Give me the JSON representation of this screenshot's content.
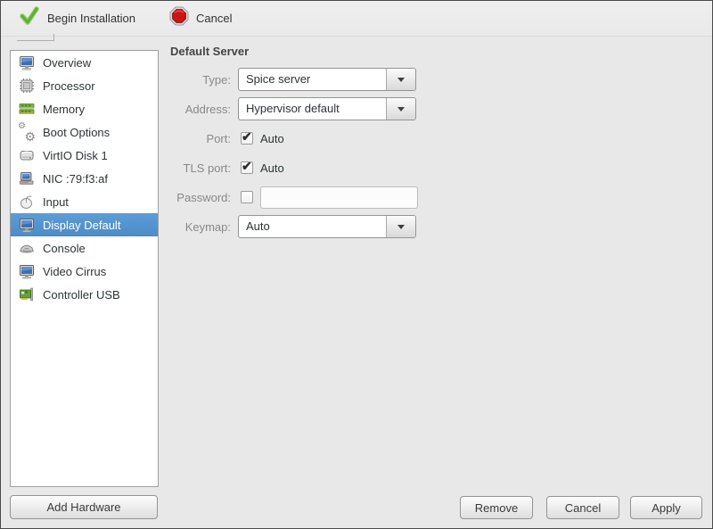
{
  "toolbar": {
    "begin_label": "Begin Installation",
    "begin_icon": "green-checkmark-icon",
    "cancel_label": "Cancel",
    "cancel_icon": "red-stop-icon"
  },
  "sidebar": {
    "items": [
      {
        "label": "Overview",
        "icon": "monitor-icon",
        "selected": false
      },
      {
        "label": "Processor",
        "icon": "cpu-icon",
        "selected": false
      },
      {
        "label": "Memory",
        "icon": "ram-icon",
        "selected": false
      },
      {
        "label": "Boot Options",
        "icon": "gears-icon",
        "selected": false
      },
      {
        "label": "VirtIO Disk 1",
        "icon": "disk-icon",
        "selected": false
      },
      {
        "label": "NIC :79:f3:af",
        "icon": "network-pc-icon",
        "selected": false
      },
      {
        "label": "Input",
        "icon": "mouse-icon",
        "selected": false
      },
      {
        "label": "Display Default",
        "icon": "display-icon",
        "selected": true
      },
      {
        "label": "Console",
        "icon": "console-icon",
        "selected": false
      },
      {
        "label": "Video Cirrus",
        "icon": "video-icon",
        "selected": false
      },
      {
        "label": "Controller USB",
        "icon": "usb-controller-icon",
        "selected": false
      }
    ],
    "add_hardware_label": "Add Hardware"
  },
  "panel": {
    "title": "Default Server",
    "type": {
      "label": "Type:",
      "value": "Spice server"
    },
    "address": {
      "label": "Address:",
      "value": "Hypervisor default"
    },
    "port": {
      "label": "Port:",
      "checked": true,
      "auto_label": "Auto"
    },
    "tls": {
      "label": "TLS port:",
      "checked": true,
      "auto_label": "Auto"
    },
    "password": {
      "label": "Password:",
      "checked": false,
      "value": ""
    },
    "keymap": {
      "label": "Keymap:",
      "value": "Auto"
    }
  },
  "footer": {
    "remove_label": "Remove",
    "cancel_label": "Cancel",
    "apply_label": "Apply"
  },
  "colors": {
    "selection_blue": "#5294cf",
    "window_bg": "#e8e8e8",
    "toolbar_bg": "#ececec",
    "check_green": "#5bb52a",
    "stop_red": "#cc1414",
    "label_gray": "#87898a"
  }
}
